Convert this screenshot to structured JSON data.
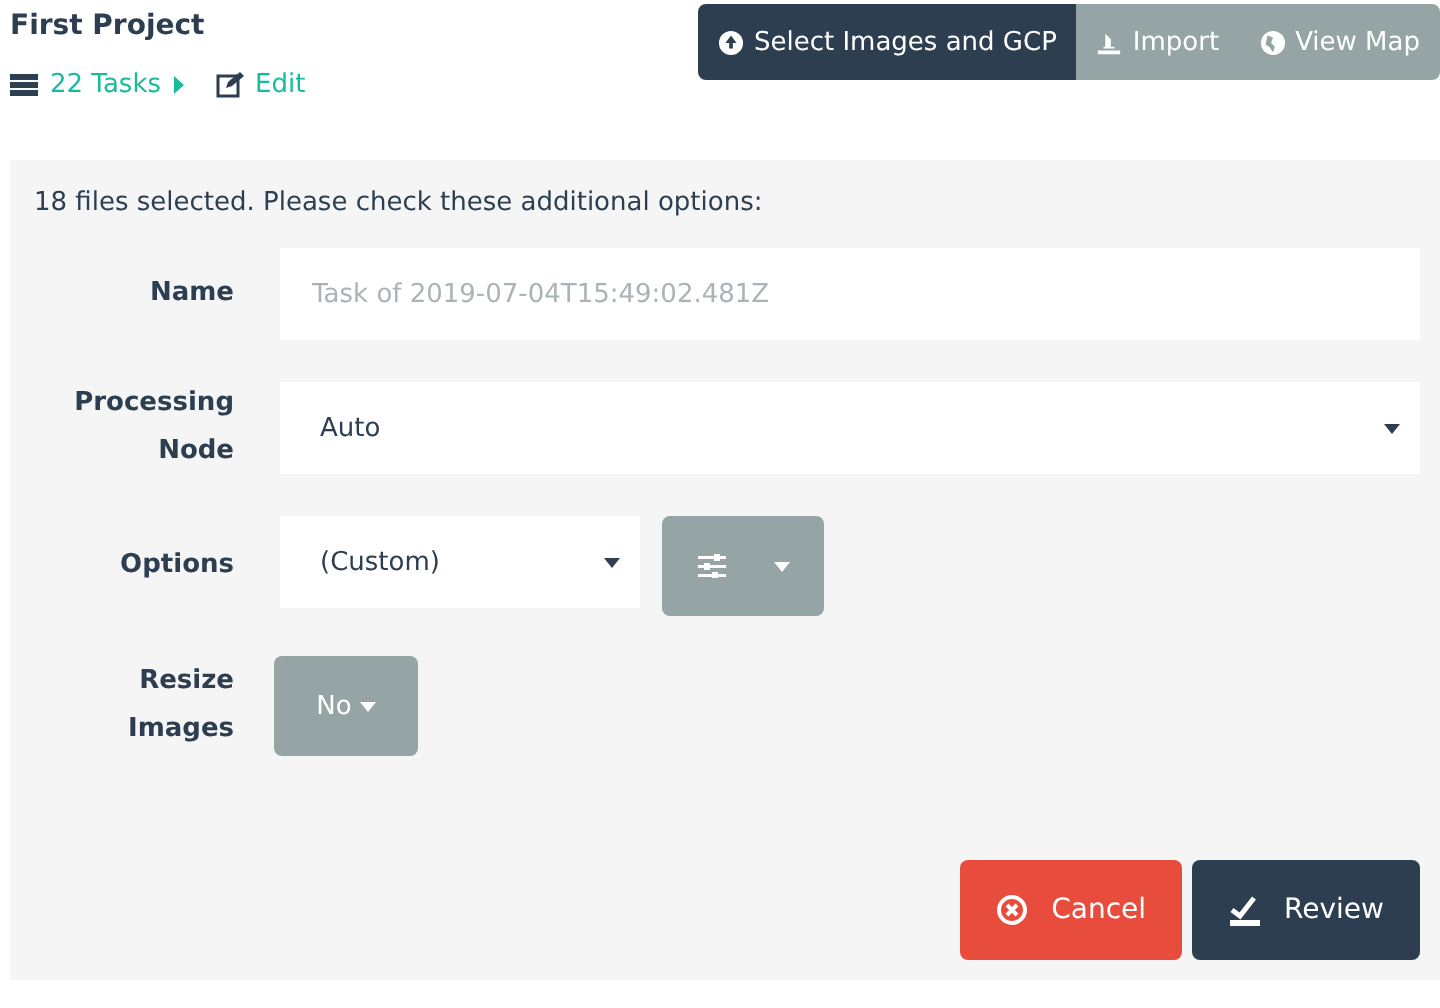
{
  "project": {
    "title": "First Project",
    "tasks_link": "22 Tasks",
    "edit_link": "Edit"
  },
  "tabs": [
    {
      "label": "Select Images and GCP",
      "kind": "upload",
      "selected": true
    },
    {
      "label": "Import",
      "kind": "import",
      "selected": false
    },
    {
      "label": "View Map",
      "kind": "globe",
      "selected": false
    }
  ],
  "form": {
    "message": "18 files selected. Please check these additional options:",
    "fields": [
      {
        "label": "Name",
        "kind": "text",
        "placeholder": "Task of 2019-07-04T15:49:02.481Z"
      },
      {
        "label": "Processing Node",
        "kind": "select",
        "value": "Auto"
      },
      {
        "label": "Options",
        "kind": "options",
        "value": "(Custom)"
      },
      {
        "label": "Resize Images",
        "kind": "toggle",
        "value": "No"
      }
    ]
  },
  "buttons": [
    {
      "label": "Cancel",
      "kind": "cancel"
    },
    {
      "label": "Review",
      "kind": "review"
    }
  ]
}
